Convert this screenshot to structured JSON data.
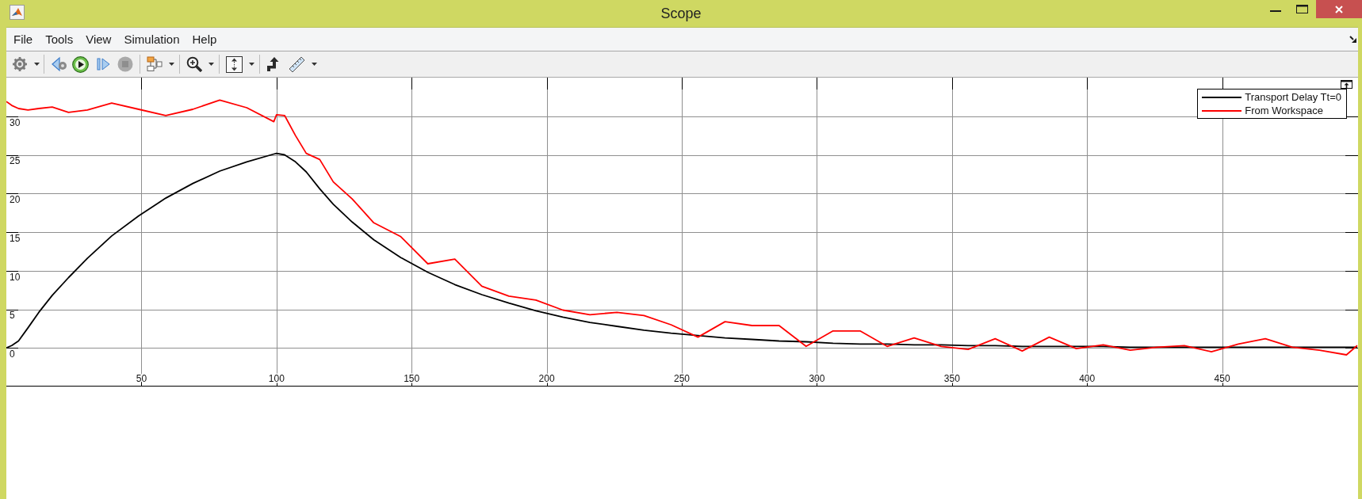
{
  "window": {
    "title": "Scope"
  },
  "menu_bar": [
    "File",
    "Tools",
    "View",
    "Simulation",
    "Help"
  ],
  "toolbar": {
    "stop_button": {
      "disabled": true
    }
  },
  "plot": {
    "chart_data": {
      "type": "line",
      "x": [
        0,
        2,
        4.5,
        8,
        12,
        17,
        23,
        30,
        39,
        49,
        59,
        69,
        79,
        89,
        99,
        100,
        103,
        107,
        111,
        116,
        121,
        128,
        136,
        146,
        156,
        166,
        176,
        186,
        196,
        206,
        216,
        226,
        236,
        246,
        256,
        266,
        276,
        286,
        296,
        306,
        316,
        326,
        336,
        346,
        356,
        366,
        376,
        386,
        396,
        406,
        416,
        426,
        436,
        446,
        456,
        466,
        476,
        486,
        496,
        500
      ],
      "series": [
        {
          "name": "Transport Delay Tt=0",
          "color": "#000000",
          "values": [
            0,
            0.3,
            0.9,
            2.6,
            4.6,
            6.8,
            9.1,
            11.6,
            14.5,
            17.1,
            19.4,
            21.3,
            22.9,
            24.1,
            25.1,
            25.2,
            25.0,
            24.1,
            22.8,
            20.6,
            18.6,
            16.3,
            14.0,
            11.7,
            9.8,
            8.2,
            6.9,
            5.8,
            4.8,
            4.0,
            3.3,
            2.8,
            2.3,
            1.9,
            1.6,
            1.3,
            1.1,
            0.9,
            0.8,
            0.6,
            0.5,
            0.5,
            0.4,
            0.4,
            0.3,
            0.3,
            0.2,
            0.2,
            0.2,
            0.2,
            0.1,
            0.1,
            0.1,
            0.1,
            0.1,
            0.1,
            0.1,
            0.1,
            0.1,
            0.1
          ]
        },
        {
          "name": "From Workspace",
          "color": "#ff0000",
          "values": [
            31.9,
            31.4,
            31.0,
            30.8,
            31.0,
            31.2,
            30.5,
            30.8,
            31.7,
            30.9,
            30.1,
            30.9,
            32.1,
            31.1,
            29.3,
            30.2,
            30.1,
            27.5,
            25.2,
            24.4,
            21.5,
            19.3,
            16.2,
            14.4,
            10.9,
            11.5,
            8.0,
            6.7,
            6.2,
            4.9,
            4.3,
            4.6,
            4.2,
            3.0,
            1.4,
            3.4,
            2.9,
            2.9,
            0.2,
            2.2,
            2.2,
            0.2,
            1.3,
            0.2,
            -0.2,
            1.2,
            -0.4,
            1.4,
            -0.1,
            0.4,
            -0.3,
            0.1,
            0.3,
            -0.5,
            0.5,
            1.2,
            0.1,
            -0.3,
            -0.9,
            0.3
          ]
        }
      ],
      "xlim": [
        0,
        500
      ],
      "ylim": [
        -5,
        35
      ],
      "xticks": [
        50,
        100,
        150,
        200,
        250,
        300,
        350,
        400,
        450
      ],
      "yticks": [
        0,
        5,
        10,
        15,
        20,
        25,
        30
      ],
      "grid": true,
      "legend": "upper right"
    }
  }
}
